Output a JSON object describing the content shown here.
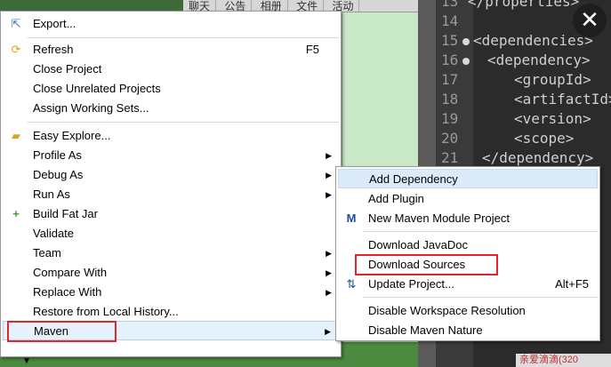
{
  "background": {
    "tabs": [
      "聊天",
      "公告",
      "相册",
      "文件",
      "活动"
    ],
    "bottom_right_text": "亲爱滴滴(320",
    "code_lines": [
      {
        "num": "13",
        "text": "</properties>",
        "fold": false
      },
      {
        "num": "14",
        "text": "",
        "fold": false
      },
      {
        "num": "15",
        "text": "<dependencies>",
        "fold": true
      },
      {
        "num": "16",
        "text": "<dependency>",
        "fold": true
      },
      {
        "num": "17",
        "text": "<groupId>",
        "fold": false
      },
      {
        "num": "18",
        "text": "<artifactId>",
        "fold": false
      },
      {
        "num": "19",
        "text": "<version>",
        "fold": false
      },
      {
        "num": "20",
        "text": "<scope>",
        "fold": false
      },
      {
        "num": "21",
        "text": "</dependency>",
        "fold": false
      }
    ],
    "close_glyph": "✕"
  },
  "main_menu": {
    "items": [
      {
        "label": "Export...",
        "icon": "export-icon",
        "glyph": "⇱"
      },
      {
        "label": "Refresh",
        "icon": "refresh-icon",
        "glyph": "⟳",
        "accel": "F5"
      },
      {
        "label": "Close Project"
      },
      {
        "label": "Close Unrelated Projects"
      },
      {
        "label": "Assign Working Sets..."
      },
      {
        "label": "Easy Explore...",
        "icon": "folder-icon",
        "glyph": "▰"
      },
      {
        "label": "Profile As",
        "submenu": true
      },
      {
        "label": "Debug As",
        "submenu": true
      },
      {
        "label": "Run As",
        "submenu": true
      },
      {
        "label": "Build Fat Jar",
        "icon": "plus-icon",
        "glyph": "+"
      },
      {
        "label": "Validate"
      },
      {
        "label": "Team",
        "submenu": true
      },
      {
        "label": "Compare With",
        "submenu": true
      },
      {
        "label": "Replace With",
        "submenu": true
      },
      {
        "label": "Restore from Local History..."
      },
      {
        "label": "Maven",
        "submenu": true
      }
    ],
    "arrow_glyph": "▶",
    "more_glyph": "▼"
  },
  "maven_submenu": {
    "items": [
      {
        "label": "Add Dependency"
      },
      {
        "label": "Add Plugin"
      },
      {
        "label": "New Maven Module Project",
        "icon": "maven-icon",
        "glyph": "M"
      },
      {
        "label": "Download JavaDoc"
      },
      {
        "label": "Download Sources"
      },
      {
        "label": "Update Project...",
        "icon": "maven-update-icon",
        "glyph": "⇅",
        "accel": "Alt+F5"
      },
      {
        "label": "Disable Workspace Resolution"
      },
      {
        "label": "Disable Maven Nature"
      }
    ]
  },
  "colors": {
    "highlight_red": "#e2262b",
    "hover_blue": "#e5f1fb"
  }
}
